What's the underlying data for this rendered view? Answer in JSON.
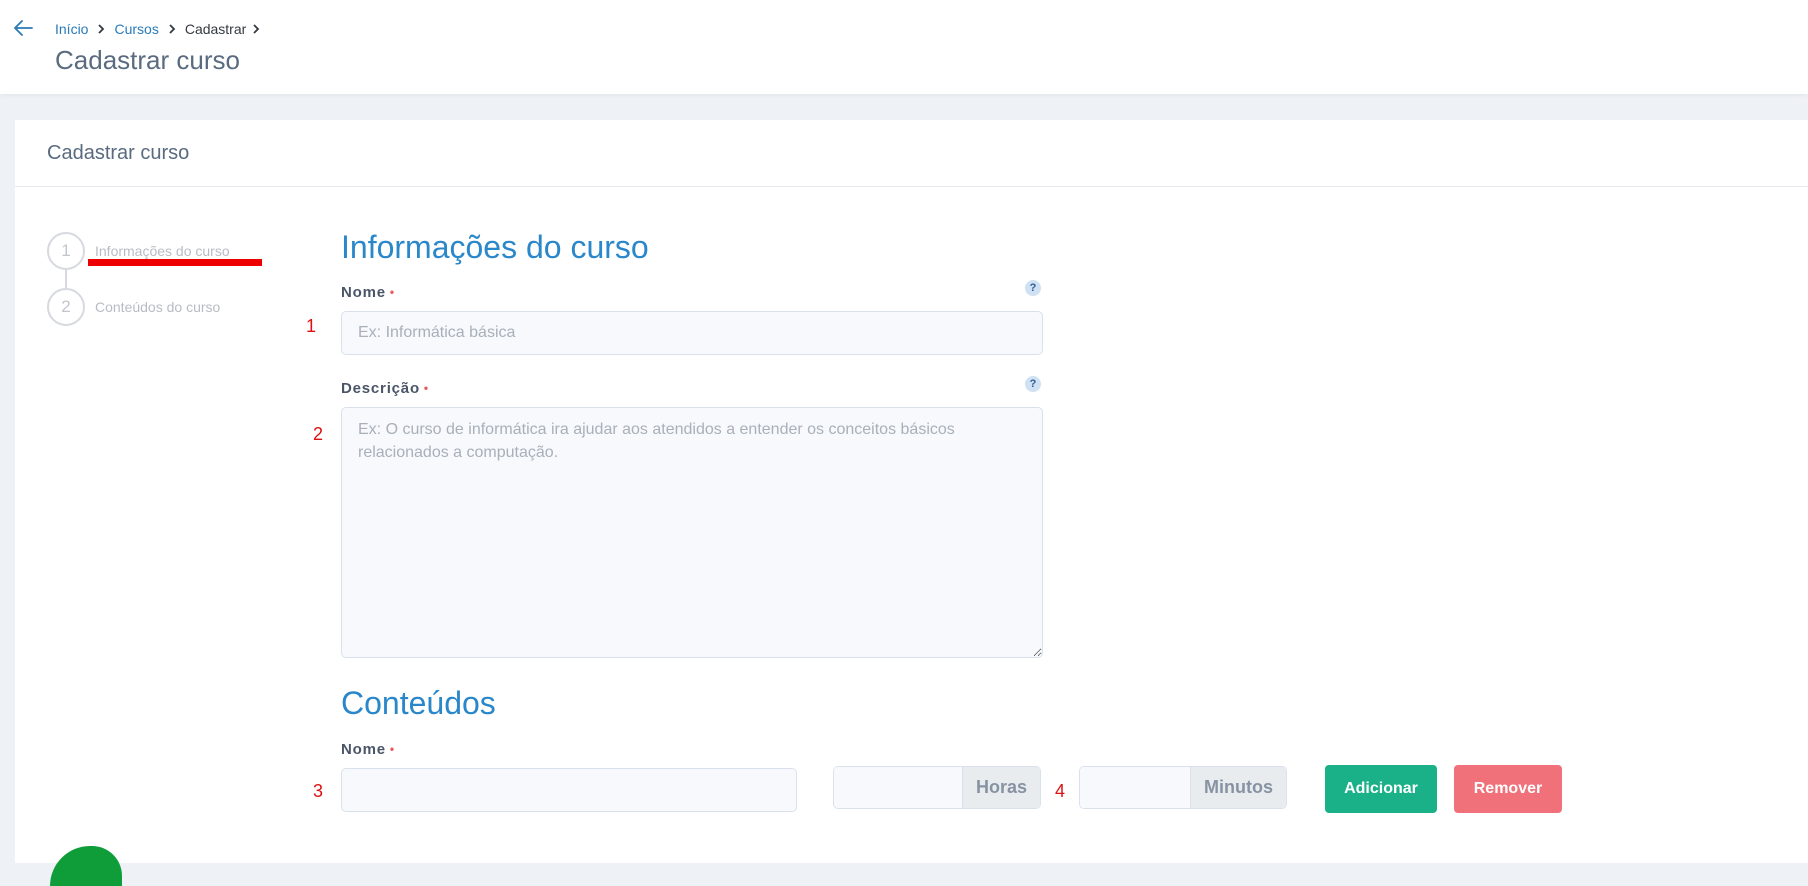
{
  "breadcrumb": {
    "items": [
      {
        "label": "Início"
      },
      {
        "label": "Cursos"
      },
      {
        "label": "Cadastrar"
      }
    ]
  },
  "page": {
    "title": "Cadastrar curso"
  },
  "card": {
    "title": "Cadastrar curso"
  },
  "stepper": {
    "steps": [
      {
        "number": "1",
        "label": "Informações do curso"
      },
      {
        "number": "2",
        "label": "Conteúdos do curso"
      }
    ]
  },
  "info_section": {
    "title": "Informações do curso",
    "nome": {
      "label": "Nome",
      "required_marker": "•",
      "placeholder": "Ex: Informática básica",
      "value": ""
    },
    "descricao": {
      "label": "Descrição",
      "required_marker": "•",
      "placeholder": "Ex: O curso de informática ira ajudar aos atendidos a entender os conceitos básicos relacionados a computação.",
      "value": ""
    },
    "help_glyph": "?"
  },
  "content_section": {
    "title": "Conteúdos",
    "nome": {
      "label": "Nome",
      "required_marker": "•",
      "value": ""
    },
    "hours": {
      "value": "",
      "addon": "Horas"
    },
    "minutes": {
      "value": "",
      "addon": "Minutos"
    },
    "add_button": "Adicionar",
    "remove_button": "Remover"
  },
  "annotations": [
    "1",
    "2",
    "3",
    "4"
  ],
  "colors": {
    "link": "#2a7ab8",
    "section_title": "#2a87c9",
    "add_button": "#1ab188",
    "remove_button": "#f0717a",
    "required": "#e85a5a",
    "annotation": "#dd1111"
  },
  "icons": {
    "back": "arrow-left-icon",
    "separator": "chevron-right-icon",
    "help": "question-circle-icon"
  }
}
